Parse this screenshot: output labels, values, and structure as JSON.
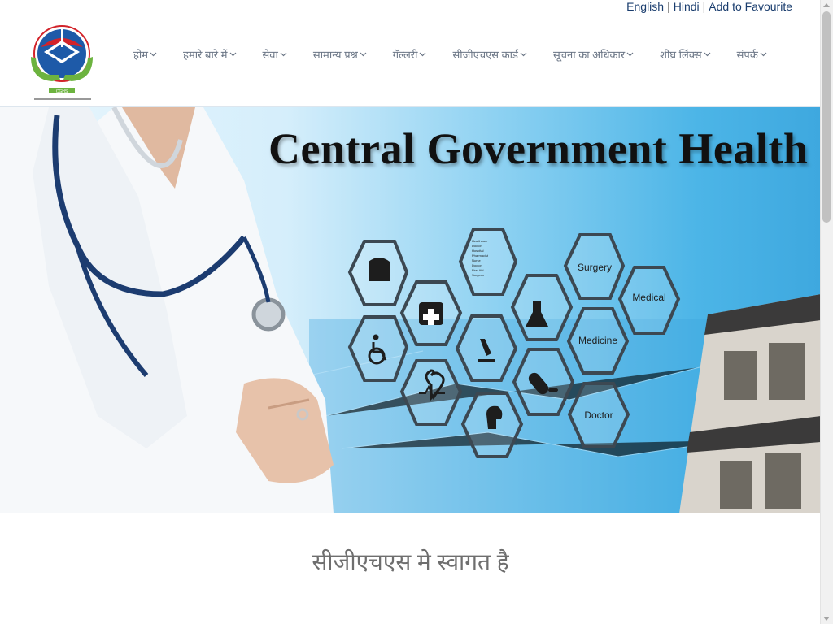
{
  "top_links": {
    "english": "English",
    "hindi": "Hindi",
    "separator": "|",
    "favourite": "Add to Favourite"
  },
  "logo": {
    "name": "CGHS logo",
    "badge_text": "CGHS"
  },
  "nav": {
    "items": [
      {
        "label": "होम"
      },
      {
        "label": "हमारे बारे में"
      },
      {
        "label": "सेवा"
      },
      {
        "label": "सामान्य प्रश्न"
      },
      {
        "label": "गॅल्लरी"
      },
      {
        "label": "सीजीएचएस कार्ड"
      },
      {
        "label": "सूचना का अधिकार"
      },
      {
        "label": "शीघ्र लिंक्स"
      },
      {
        "label": "संपर्क"
      }
    ],
    "chevron_icon": "chevron-down-icon"
  },
  "banner": {
    "title": "Central Government Health Scheme",
    "hexagons": {
      "surgery": "Surgery",
      "medical": "Medical",
      "medicine": "Medicine",
      "doctor": "Doctor",
      "list": [
        "Healthcare",
        "Doctor",
        "Hospital",
        "Pharmacist",
        "Nurse",
        "Doctor",
        "First Aid",
        "Surgeon"
      ]
    }
  },
  "welcome": "सीजीएचएस मे स्वागत है",
  "colors": {
    "link": "#1a3d6e",
    "nav_text": "#6b7686",
    "accent_green": "#6cb33f",
    "accent_blue": "#1e5aa8",
    "accent_red": "#d2232a"
  }
}
